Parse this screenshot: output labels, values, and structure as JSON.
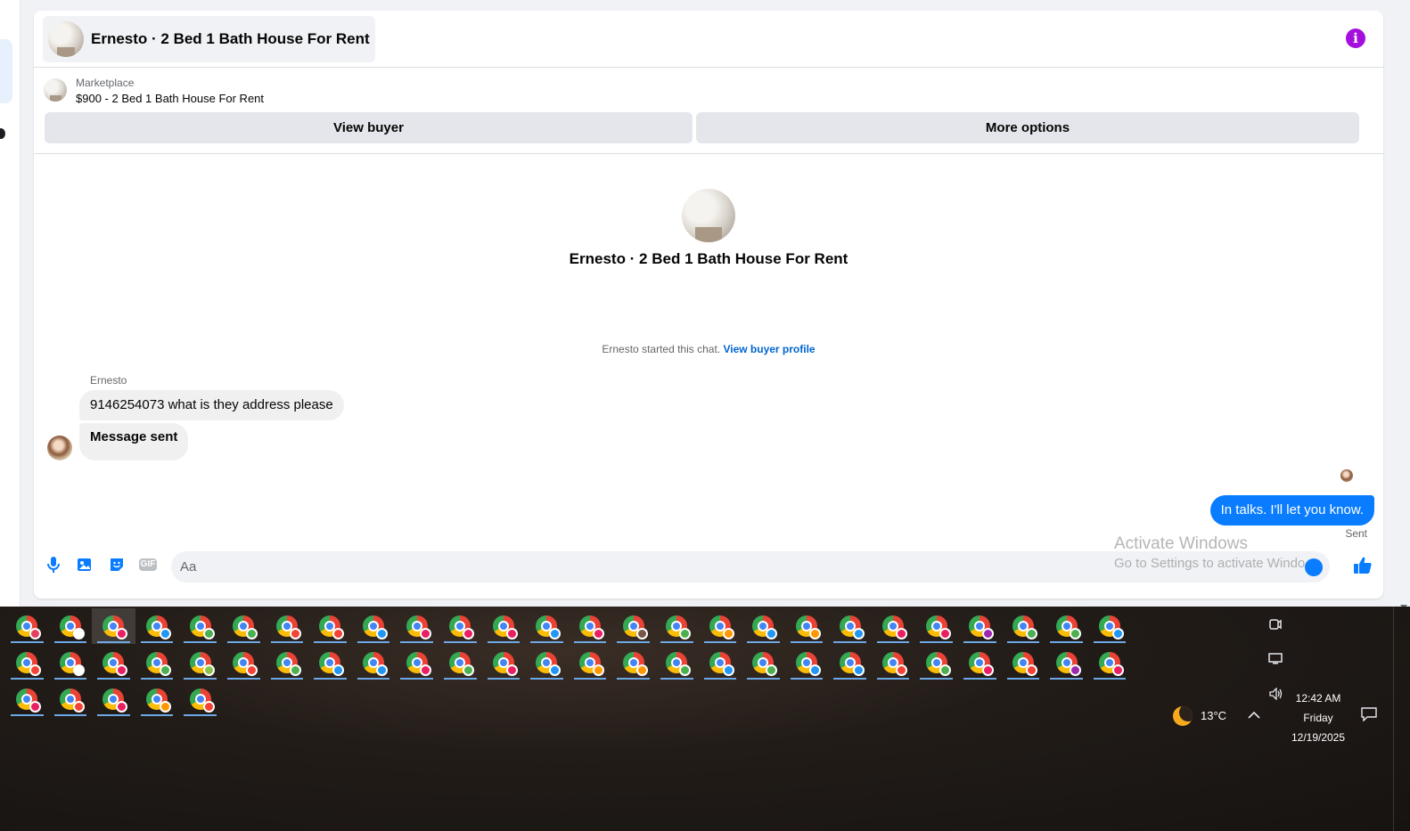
{
  "chat": {
    "title": "Ernesto · 2 Bed 1 Bath House For Rent",
    "info_icon": "info-icon",
    "listing": {
      "source": "Marketplace",
      "price_title": "$900 - 2 Bed 1 Bath House For Rent"
    },
    "buttons": {
      "view_buyer": "View buyer",
      "more_options": "More options"
    },
    "intro_name": "Ernesto · 2 Bed 1 Bath House For Rent",
    "started_text": "Ernesto started this chat.",
    "started_link": "View buyer profile",
    "messages": [
      {
        "sender": "Ernesto",
        "text": "9146254073 what is they address please",
        "direction": "incoming"
      },
      {
        "sender": "",
        "text": "Message sent",
        "direction": "incoming"
      },
      {
        "sender": "me",
        "text": "In talks. I'll let you know.",
        "direction": "outgoing",
        "status": "Sent"
      }
    ],
    "composer": {
      "placeholder": "Aa",
      "icons": [
        "mic-icon",
        "photo-icon",
        "sticker-icon",
        "gif-icon",
        "emoji-icon",
        "like-icon"
      ],
      "gif_label": "GIF"
    },
    "accent_color": "#0a7cff"
  },
  "watermark": {
    "title": "Activate Windows",
    "subtitle": "Go to Settings to activate Windo"
  },
  "taskbar": {
    "rows": [
      [
        "#e4405f",
        "#ffffff",
        "#e91e63",
        "#2196f3",
        "#4caf50",
        "#4caf50",
        "#f44336",
        "#f44336",
        "#2196f3",
        "#e91e63",
        "#e91e63",
        "#e91e63",
        "#2196f3",
        "#e91e63",
        "#795548",
        "#4caf50",
        "#ff9800",
        "#2196f3",
        "#ff9800",
        "#2196f3",
        "#e91e63",
        "#e91e63",
        "#9c27b0",
        "#4caf50",
        "#4caf50",
        "#2196f3"
      ],
      [
        "#f44336",
        "#ffffff",
        "#e91e63",
        "#4caf50",
        "#8bc34a",
        "#f44336",
        "#4caf50",
        "#2196f3",
        "#2196f3",
        "#e91e63",
        "#4caf50",
        "#e91e63",
        "#2196f3",
        "#ff9800",
        "#ff9800",
        "#4caf50",
        "#2196f3",
        "#4caf50",
        "#2196f3",
        "#2196f3",
        "#f44336",
        "#4caf50",
        "#e91e63",
        "#f44336",
        "#9c27b0",
        "#e91e63"
      ],
      [
        "#e91e63",
        "#f44336",
        "#e91e63",
        "#ff9800",
        "#f44336"
      ]
    ],
    "active_index": 2,
    "weather": {
      "temperature": "13°C",
      "icon": "moon-icon"
    },
    "clock": {
      "time": "12:42 AM",
      "day": "Friday",
      "date": "12/19/2025"
    },
    "tray_icons": [
      "meet-now-icon",
      "display-icon",
      "volume-icon",
      "chevron-up-icon",
      "notification-icon"
    ]
  }
}
